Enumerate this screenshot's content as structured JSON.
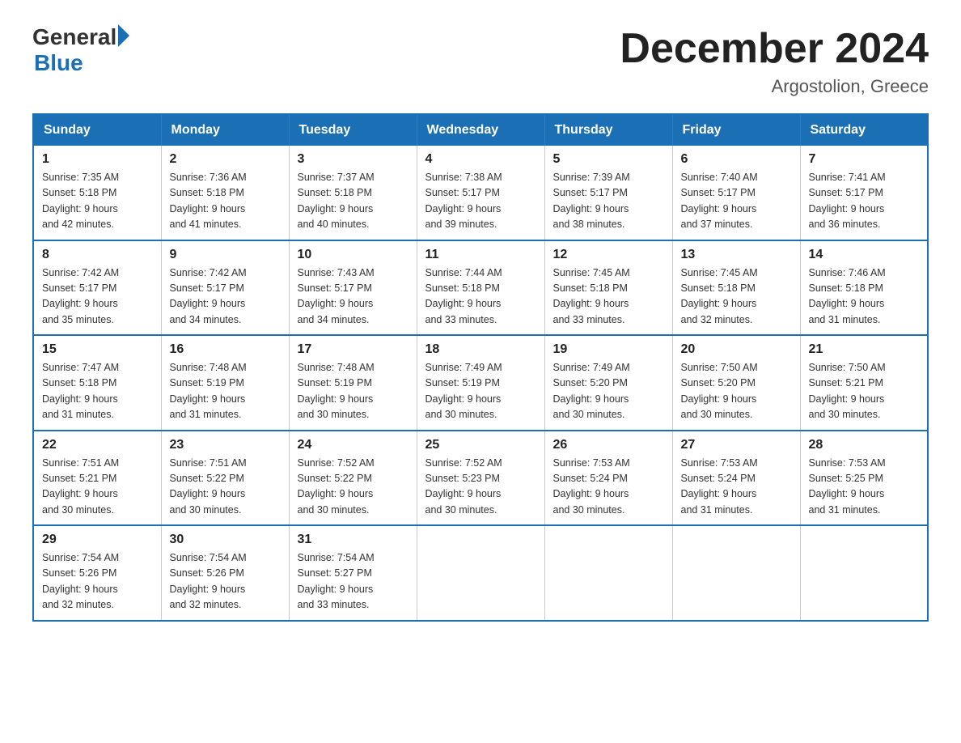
{
  "header": {
    "logo_general": "General",
    "logo_blue": "Blue",
    "title": "December 2024",
    "subtitle": "Argostolion, Greece"
  },
  "calendar": {
    "days_of_week": [
      "Sunday",
      "Monday",
      "Tuesday",
      "Wednesday",
      "Thursday",
      "Friday",
      "Saturday"
    ],
    "weeks": [
      [
        {
          "day": "1",
          "sunrise": "7:35 AM",
          "sunset": "5:18 PM",
          "daylight": "9 hours and 42 minutes."
        },
        {
          "day": "2",
          "sunrise": "7:36 AM",
          "sunset": "5:18 PM",
          "daylight": "9 hours and 41 minutes."
        },
        {
          "day": "3",
          "sunrise": "7:37 AM",
          "sunset": "5:18 PM",
          "daylight": "9 hours and 40 minutes."
        },
        {
          "day": "4",
          "sunrise": "7:38 AM",
          "sunset": "5:17 PM",
          "daylight": "9 hours and 39 minutes."
        },
        {
          "day": "5",
          "sunrise": "7:39 AM",
          "sunset": "5:17 PM",
          "daylight": "9 hours and 38 minutes."
        },
        {
          "day": "6",
          "sunrise": "7:40 AM",
          "sunset": "5:17 PM",
          "daylight": "9 hours and 37 minutes."
        },
        {
          "day": "7",
          "sunrise": "7:41 AM",
          "sunset": "5:17 PM",
          "daylight": "9 hours and 36 minutes."
        }
      ],
      [
        {
          "day": "8",
          "sunrise": "7:42 AM",
          "sunset": "5:17 PM",
          "daylight": "9 hours and 35 minutes."
        },
        {
          "day": "9",
          "sunrise": "7:42 AM",
          "sunset": "5:17 PM",
          "daylight": "9 hours and 34 minutes."
        },
        {
          "day": "10",
          "sunrise": "7:43 AM",
          "sunset": "5:17 PM",
          "daylight": "9 hours and 34 minutes."
        },
        {
          "day": "11",
          "sunrise": "7:44 AM",
          "sunset": "5:18 PM",
          "daylight": "9 hours and 33 minutes."
        },
        {
          "day": "12",
          "sunrise": "7:45 AM",
          "sunset": "5:18 PM",
          "daylight": "9 hours and 33 minutes."
        },
        {
          "day": "13",
          "sunrise": "7:45 AM",
          "sunset": "5:18 PM",
          "daylight": "9 hours and 32 minutes."
        },
        {
          "day": "14",
          "sunrise": "7:46 AM",
          "sunset": "5:18 PM",
          "daylight": "9 hours and 31 minutes."
        }
      ],
      [
        {
          "day": "15",
          "sunrise": "7:47 AM",
          "sunset": "5:18 PM",
          "daylight": "9 hours and 31 minutes."
        },
        {
          "day": "16",
          "sunrise": "7:48 AM",
          "sunset": "5:19 PM",
          "daylight": "9 hours and 31 minutes."
        },
        {
          "day": "17",
          "sunrise": "7:48 AM",
          "sunset": "5:19 PM",
          "daylight": "9 hours and 30 minutes."
        },
        {
          "day": "18",
          "sunrise": "7:49 AM",
          "sunset": "5:19 PM",
          "daylight": "9 hours and 30 minutes."
        },
        {
          "day": "19",
          "sunrise": "7:49 AM",
          "sunset": "5:20 PM",
          "daylight": "9 hours and 30 minutes."
        },
        {
          "day": "20",
          "sunrise": "7:50 AM",
          "sunset": "5:20 PM",
          "daylight": "9 hours and 30 minutes."
        },
        {
          "day": "21",
          "sunrise": "7:50 AM",
          "sunset": "5:21 PM",
          "daylight": "9 hours and 30 minutes."
        }
      ],
      [
        {
          "day": "22",
          "sunrise": "7:51 AM",
          "sunset": "5:21 PM",
          "daylight": "9 hours and 30 minutes."
        },
        {
          "day": "23",
          "sunrise": "7:51 AM",
          "sunset": "5:22 PM",
          "daylight": "9 hours and 30 minutes."
        },
        {
          "day": "24",
          "sunrise": "7:52 AM",
          "sunset": "5:22 PM",
          "daylight": "9 hours and 30 minutes."
        },
        {
          "day": "25",
          "sunrise": "7:52 AM",
          "sunset": "5:23 PM",
          "daylight": "9 hours and 30 minutes."
        },
        {
          "day": "26",
          "sunrise": "7:53 AM",
          "sunset": "5:24 PM",
          "daylight": "9 hours and 30 minutes."
        },
        {
          "day": "27",
          "sunrise": "7:53 AM",
          "sunset": "5:24 PM",
          "daylight": "9 hours and 31 minutes."
        },
        {
          "day": "28",
          "sunrise": "7:53 AM",
          "sunset": "5:25 PM",
          "daylight": "9 hours and 31 minutes."
        }
      ],
      [
        {
          "day": "29",
          "sunrise": "7:54 AM",
          "sunset": "5:26 PM",
          "daylight": "9 hours and 32 minutes."
        },
        {
          "day": "30",
          "sunrise": "7:54 AM",
          "sunset": "5:26 PM",
          "daylight": "9 hours and 32 minutes."
        },
        {
          "day": "31",
          "sunrise": "7:54 AM",
          "sunset": "5:27 PM",
          "daylight": "9 hours and 33 minutes."
        },
        null,
        null,
        null,
        null
      ]
    ],
    "labels": {
      "sunrise": "Sunrise: ",
      "sunset": "Sunset: ",
      "daylight": "Daylight: "
    }
  }
}
